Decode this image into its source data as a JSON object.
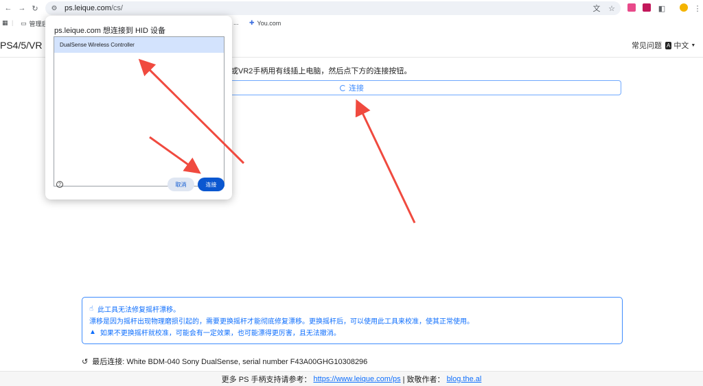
{
  "browser": {
    "url_host": "ps.leique.com",
    "url_path": "/cs/",
    "bookmarks": [
      "管理后",
      "You.com"
    ],
    "bookmark_truncated": "..."
  },
  "header": {
    "brand": "PS4/5/VR 手",
    "faq": "常见问题",
    "lang_badge": "A",
    "lang": "中文"
  },
  "main": {
    "instruction": "或VR2手柄用有线插上电脑，然后点下方的连接按钮。",
    "connect_label": "连接"
  },
  "alert": {
    "line1": "此工具无法修复摇杆漂移。",
    "line2": "漂移是因为摇杆出现物理磨损引起的，需要更换摇杆才能彻底修复漂移。更换摇杆后，可以使用此工具来校准，使其正常使用。",
    "line3": "如果不更换摇杆就校准，可能会有一定效果，也可能漂得更厉害，且无法撤消。"
  },
  "last_connection": "最后连接: White BDM-040 Sony DualSense, serial number F43A00GHG10308296",
  "footer": {
    "prefix": "更多 PS 手柄支持请参考：",
    "link1": "https://www.leique.com/ps",
    "sep": " | 致敬作者：",
    "link2": "blog.the.al"
  },
  "dialog": {
    "title": "ps.leique.com 想连接到 HID 设备",
    "device": "DualSense Wireless Controller",
    "cancel": "取消",
    "connect": "连接"
  },
  "colors": {
    "accent": "#0d6efd",
    "dialog_primary": "#0b57d0",
    "arrow": "#f04a3f"
  }
}
